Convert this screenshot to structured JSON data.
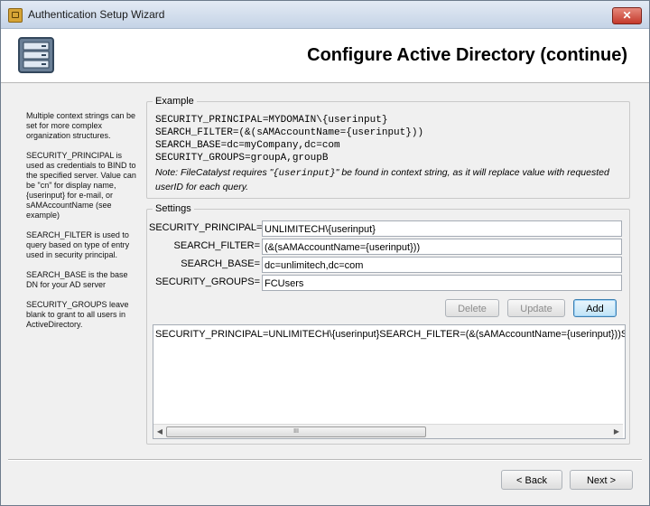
{
  "window": {
    "title": "Authentication Setup Wizard",
    "close_label": "✕"
  },
  "banner": {
    "title": "Configure Active Directory (continue)",
    "icon": "server-rack-icon"
  },
  "help_text": [
    "Multiple context strings can be set for more complex organization structures.",
    "SECURITY_PRINCIPAL is used as credentials to BIND to the specified server. Value can be \"cn\" for display name, {userinput} for e-mail, or sAMAccountName (see example)",
    "SEARCH_FILTER is used to query based on type of entry used in security principal.",
    "SEARCH_BASE is the base DN for your AD server",
    "SECURITY_GROUPS leave blank to grant to all users in ActiveDirectory."
  ],
  "example": {
    "legend": "Example",
    "lines": [
      "SECURITY_PRINCIPAL=MYDOMAIN\\{userinput}",
      "SEARCH_FILTER=(&(sAMAccountName={userinput}))",
      "SEARCH_BASE=dc=myCompany,dc=com",
      "SECURITY_GROUPS=groupA,groupB"
    ],
    "note_prefix": "Note:  FileCatalyst requires \"",
    "note_code": "{userinput}",
    "note_suffix": "\" be found in context string, as it will replace value with requested userID for each query."
  },
  "settings": {
    "legend": "Settings",
    "fields": [
      {
        "label": "SECURITY_PRINCIPAL=",
        "value": "UNLIMITECH\\{userinput}"
      },
      {
        "label": "SEARCH_FILTER=",
        "value": "(&(sAMAccountName={userinput}))"
      },
      {
        "label": "SEARCH_BASE=",
        "value": "dc=unlimitech,dc=com"
      },
      {
        "label": "SECURITY_GROUPS=",
        "value": "FCUsers"
      }
    ],
    "delete_label": "Delete",
    "update_label": "Update",
    "add_label": "Add",
    "output": "SECURITY_PRINCIPAL=UNLIMITECH\\{userinput}SEARCH_FILTER=(&(sAMAccountName={userinput}))SEARCH_BASE=dc=unlimitech,dc=comSECURITY_GROUPS=FCUsers",
    "scroll_left": "◀",
    "scroll_right": "▶",
    "scroll_grip": "III"
  },
  "footer": {
    "back_label": "< Back",
    "next_label": "Next >"
  }
}
